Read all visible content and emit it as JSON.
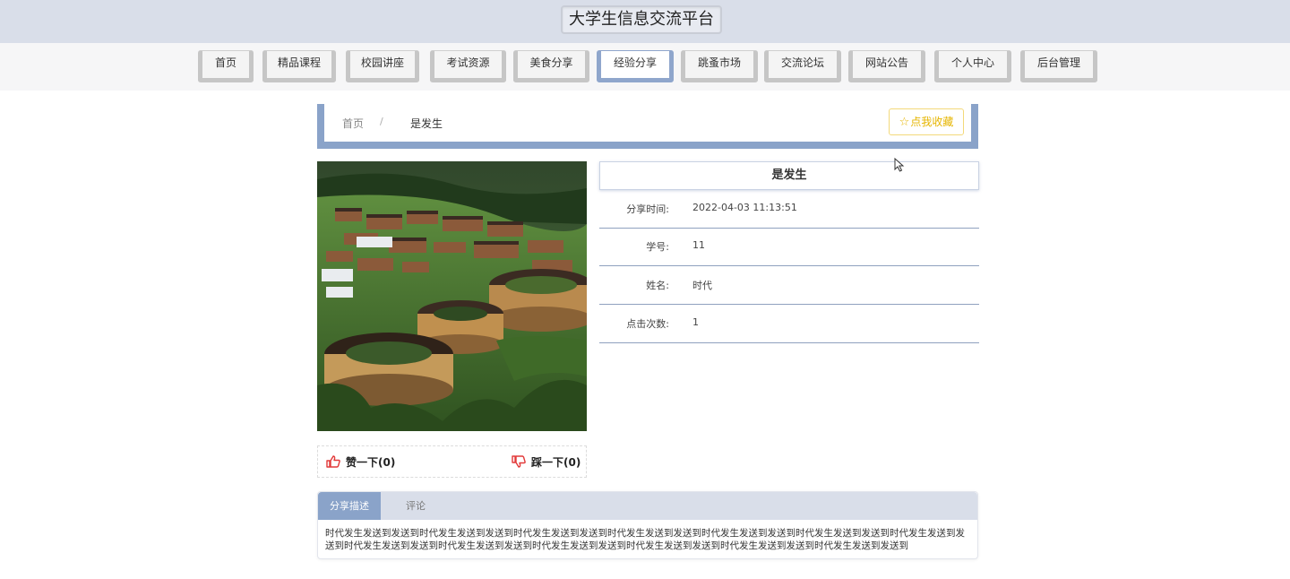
{
  "header": {
    "site_title": "大学生信息交流平台"
  },
  "nav": {
    "items": [
      {
        "label": "首页"
      },
      {
        "label": "精品课程"
      },
      {
        "label": "校园讲座"
      },
      {
        "label": "考试资源"
      },
      {
        "label": "美食分享"
      },
      {
        "label": "经验分享",
        "active": true
      },
      {
        "label": "跳蚤市场"
      },
      {
        "label": "交流论坛"
      },
      {
        "label": "网站公告"
      },
      {
        "label": "个人中心"
      },
      {
        "label": "后台管理"
      }
    ]
  },
  "breadcrumb": {
    "home": "首页",
    "separator": "/",
    "current": "是发生"
  },
  "favorite": {
    "label": "点我收藏",
    "icon": "star-outline-icon"
  },
  "reactions": {
    "like_label": "赞一下(0)",
    "dislike_label": "踩一下(0)",
    "like_icon": "thumbs-up-icon",
    "dislike_icon": "thumbs-down-icon"
  },
  "detail": {
    "title": "是发生",
    "fields": [
      {
        "key": "分享时间:",
        "value": "2022-04-03 11:13:51"
      },
      {
        "key": "学号:",
        "value": "11"
      },
      {
        "key": "姓名:",
        "value": "时代"
      },
      {
        "key": "点击次数:",
        "value": "1"
      }
    ]
  },
  "tabs": {
    "items": [
      {
        "label": "分享描述",
        "active": true
      },
      {
        "label": "评论"
      }
    ],
    "content": "时代发生发送到发送到时代发生发送到发送到时代发生发送到发送到时代发生发送到发送到时代发生发送到发送到时代发生发送到发送到时代发生发送到发送到时代发生发送到发送到时代发生发送到发送到时代发生发送到发送到时代发生发送到发送到时代发生发送到发送到时代发生发送到发送到"
  },
  "colors": {
    "accent": "#8aa3c9",
    "header_bg": "#d9dee9",
    "favorite": "#e6b500",
    "reaction_red": "#e23a3a"
  }
}
